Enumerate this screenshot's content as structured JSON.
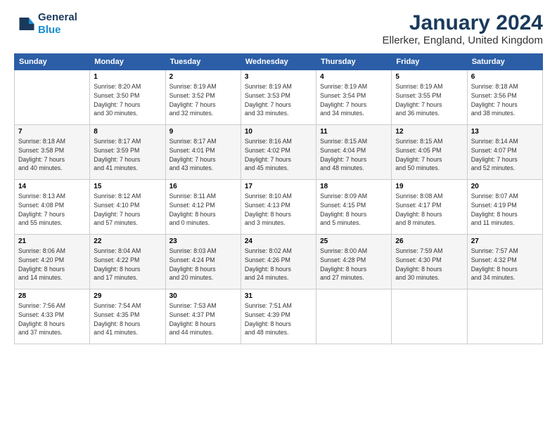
{
  "header": {
    "logo_line1": "General",
    "logo_line2": "Blue",
    "main_title": "January 2024",
    "sub_title": "Ellerker, England, United Kingdom"
  },
  "weekdays": [
    "Sunday",
    "Monday",
    "Tuesday",
    "Wednesday",
    "Thursday",
    "Friday",
    "Saturday"
  ],
  "weeks": [
    [
      {
        "day": "",
        "info": ""
      },
      {
        "day": "1",
        "info": "Sunrise: 8:20 AM\nSunset: 3:50 PM\nDaylight: 7 hours\nand 30 minutes."
      },
      {
        "day": "2",
        "info": "Sunrise: 8:19 AM\nSunset: 3:52 PM\nDaylight: 7 hours\nand 32 minutes."
      },
      {
        "day": "3",
        "info": "Sunrise: 8:19 AM\nSunset: 3:53 PM\nDaylight: 7 hours\nand 33 minutes."
      },
      {
        "day": "4",
        "info": "Sunrise: 8:19 AM\nSunset: 3:54 PM\nDaylight: 7 hours\nand 34 minutes."
      },
      {
        "day": "5",
        "info": "Sunrise: 8:19 AM\nSunset: 3:55 PM\nDaylight: 7 hours\nand 36 minutes."
      },
      {
        "day": "6",
        "info": "Sunrise: 8:18 AM\nSunset: 3:56 PM\nDaylight: 7 hours\nand 38 minutes."
      }
    ],
    [
      {
        "day": "7",
        "info": "Sunrise: 8:18 AM\nSunset: 3:58 PM\nDaylight: 7 hours\nand 40 minutes."
      },
      {
        "day": "8",
        "info": "Sunrise: 8:17 AM\nSunset: 3:59 PM\nDaylight: 7 hours\nand 41 minutes."
      },
      {
        "day": "9",
        "info": "Sunrise: 8:17 AM\nSunset: 4:01 PM\nDaylight: 7 hours\nand 43 minutes."
      },
      {
        "day": "10",
        "info": "Sunrise: 8:16 AM\nSunset: 4:02 PM\nDaylight: 7 hours\nand 45 minutes."
      },
      {
        "day": "11",
        "info": "Sunrise: 8:15 AM\nSunset: 4:04 PM\nDaylight: 7 hours\nand 48 minutes."
      },
      {
        "day": "12",
        "info": "Sunrise: 8:15 AM\nSunset: 4:05 PM\nDaylight: 7 hours\nand 50 minutes."
      },
      {
        "day": "13",
        "info": "Sunrise: 8:14 AM\nSunset: 4:07 PM\nDaylight: 7 hours\nand 52 minutes."
      }
    ],
    [
      {
        "day": "14",
        "info": "Sunrise: 8:13 AM\nSunset: 4:08 PM\nDaylight: 7 hours\nand 55 minutes."
      },
      {
        "day": "15",
        "info": "Sunrise: 8:12 AM\nSunset: 4:10 PM\nDaylight: 7 hours\nand 57 minutes."
      },
      {
        "day": "16",
        "info": "Sunrise: 8:11 AM\nSunset: 4:12 PM\nDaylight: 8 hours\nand 0 minutes."
      },
      {
        "day": "17",
        "info": "Sunrise: 8:10 AM\nSunset: 4:13 PM\nDaylight: 8 hours\nand 3 minutes."
      },
      {
        "day": "18",
        "info": "Sunrise: 8:09 AM\nSunset: 4:15 PM\nDaylight: 8 hours\nand 5 minutes."
      },
      {
        "day": "19",
        "info": "Sunrise: 8:08 AM\nSunset: 4:17 PM\nDaylight: 8 hours\nand 8 minutes."
      },
      {
        "day": "20",
        "info": "Sunrise: 8:07 AM\nSunset: 4:19 PM\nDaylight: 8 hours\nand 11 minutes."
      }
    ],
    [
      {
        "day": "21",
        "info": "Sunrise: 8:06 AM\nSunset: 4:20 PM\nDaylight: 8 hours\nand 14 minutes."
      },
      {
        "day": "22",
        "info": "Sunrise: 8:04 AM\nSunset: 4:22 PM\nDaylight: 8 hours\nand 17 minutes."
      },
      {
        "day": "23",
        "info": "Sunrise: 8:03 AM\nSunset: 4:24 PM\nDaylight: 8 hours\nand 20 minutes."
      },
      {
        "day": "24",
        "info": "Sunrise: 8:02 AM\nSunset: 4:26 PM\nDaylight: 8 hours\nand 24 minutes."
      },
      {
        "day": "25",
        "info": "Sunrise: 8:00 AM\nSunset: 4:28 PM\nDaylight: 8 hours\nand 27 minutes."
      },
      {
        "day": "26",
        "info": "Sunrise: 7:59 AM\nSunset: 4:30 PM\nDaylight: 8 hours\nand 30 minutes."
      },
      {
        "day": "27",
        "info": "Sunrise: 7:57 AM\nSunset: 4:32 PM\nDaylight: 8 hours\nand 34 minutes."
      }
    ],
    [
      {
        "day": "28",
        "info": "Sunrise: 7:56 AM\nSunset: 4:33 PM\nDaylight: 8 hours\nand 37 minutes."
      },
      {
        "day": "29",
        "info": "Sunrise: 7:54 AM\nSunset: 4:35 PM\nDaylight: 8 hours\nand 41 minutes."
      },
      {
        "day": "30",
        "info": "Sunrise: 7:53 AM\nSunset: 4:37 PM\nDaylight: 8 hours\nand 44 minutes."
      },
      {
        "day": "31",
        "info": "Sunrise: 7:51 AM\nSunset: 4:39 PM\nDaylight: 8 hours\nand 48 minutes."
      },
      {
        "day": "",
        "info": ""
      },
      {
        "day": "",
        "info": ""
      },
      {
        "day": "",
        "info": ""
      }
    ]
  ]
}
